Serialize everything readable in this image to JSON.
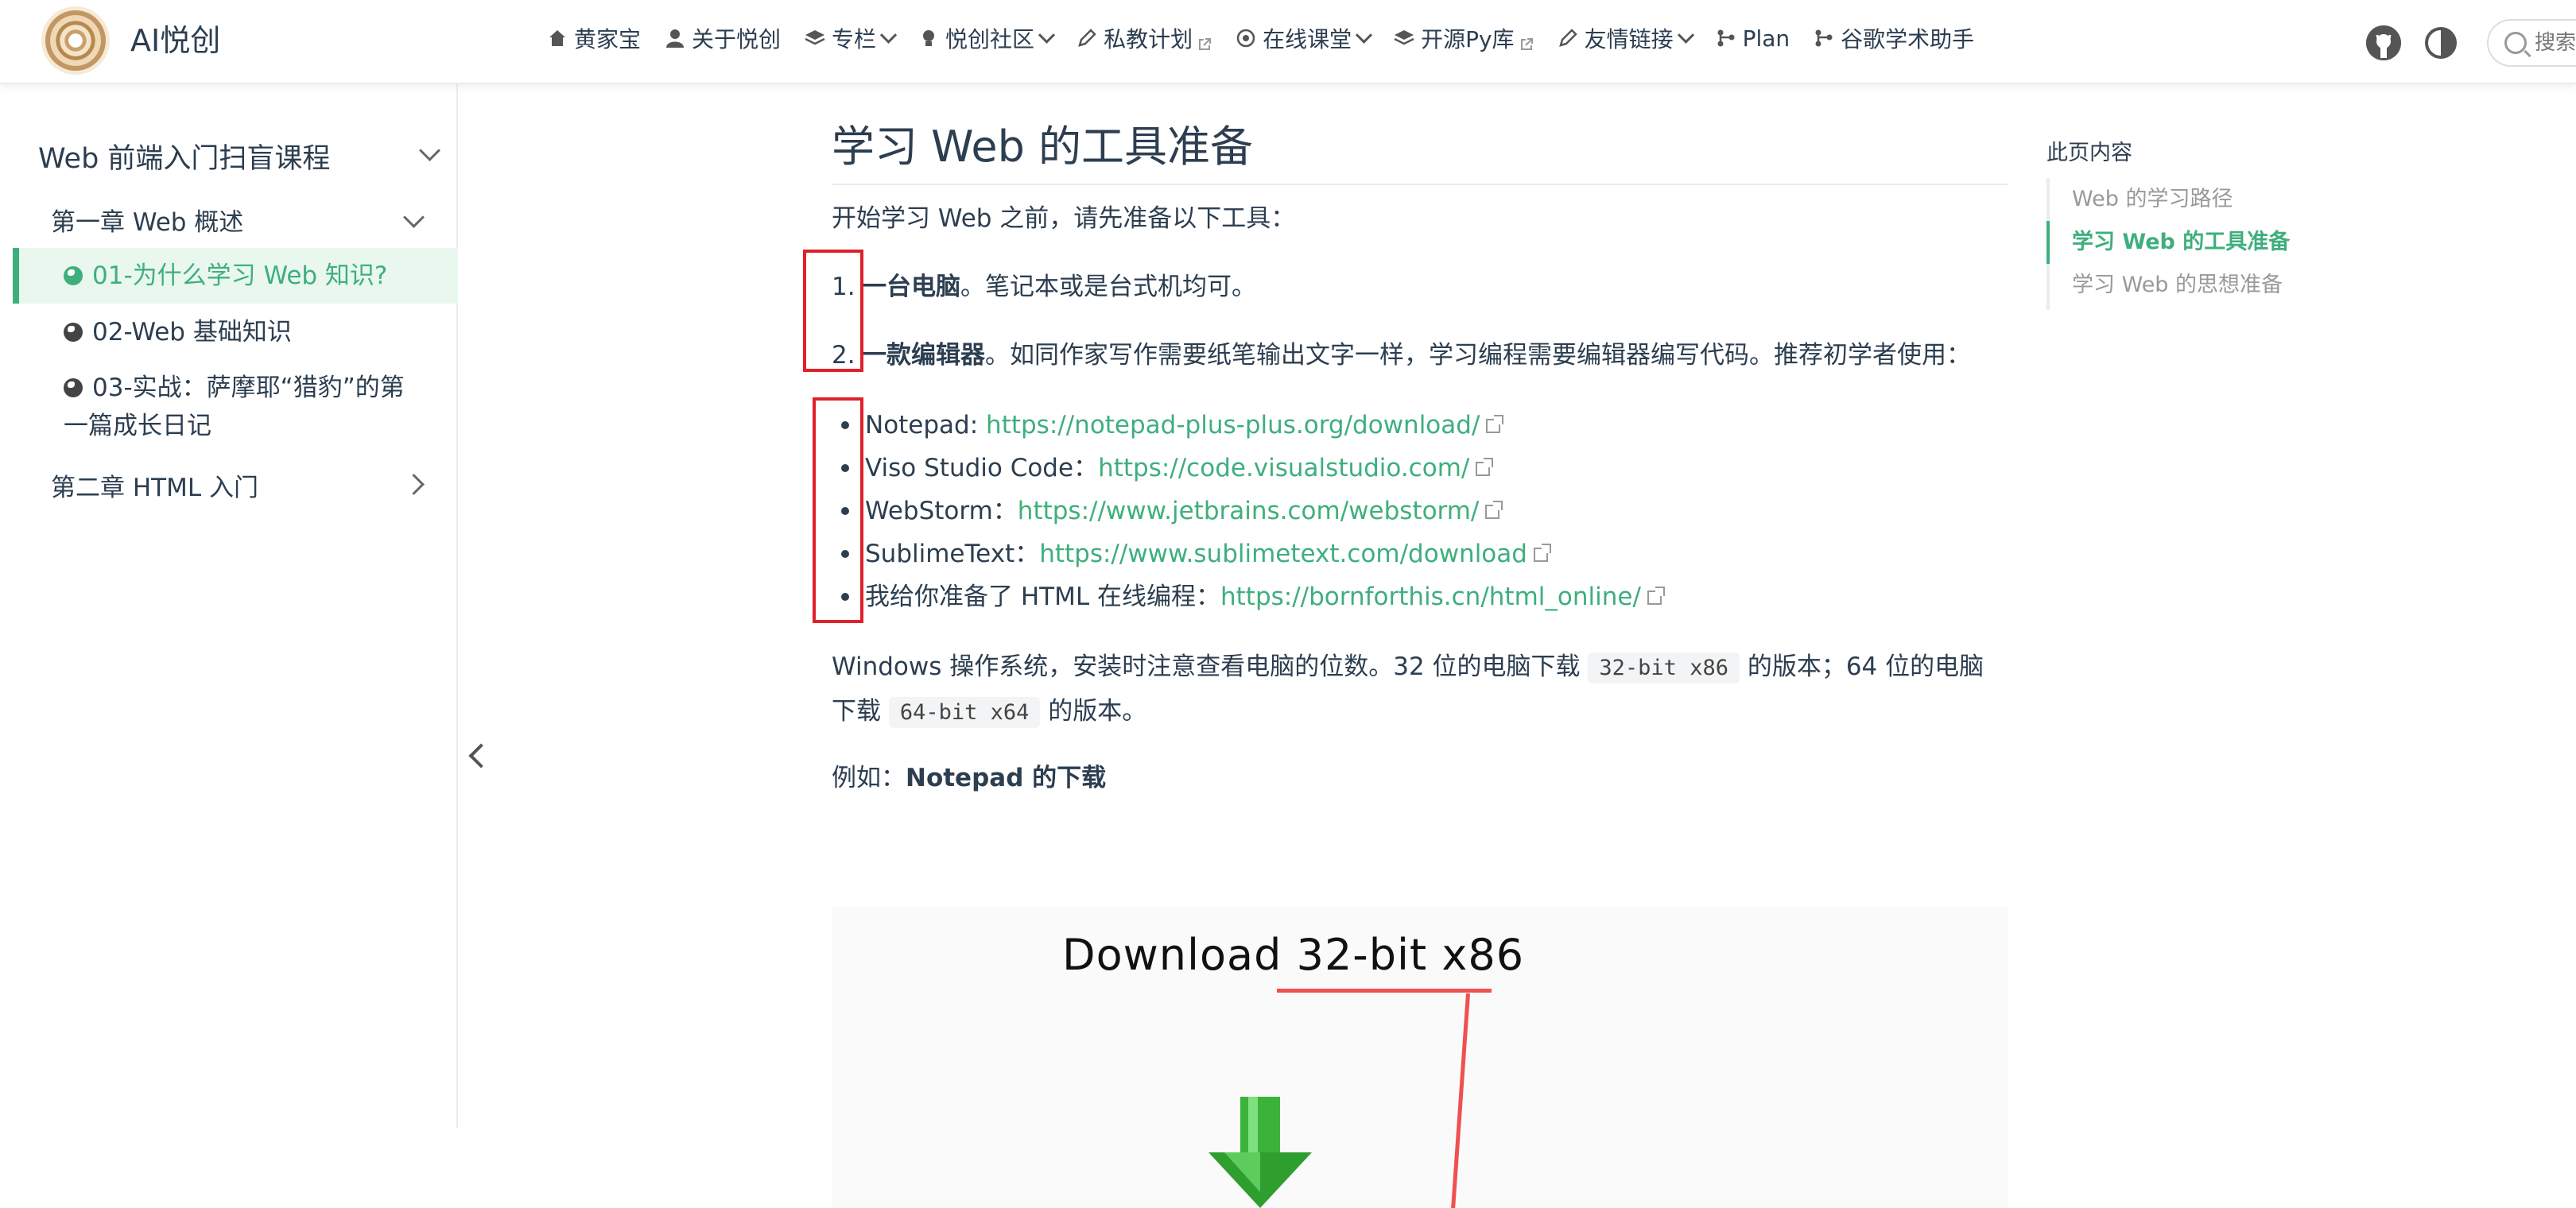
{
  "brand": {
    "name": "AI悦创"
  },
  "nav": {
    "items": [
      {
        "label": "黄家宝",
        "icon": "home-icon",
        "dropdown": false,
        "external": false
      },
      {
        "label": "关于悦创",
        "icon": "user-icon",
        "dropdown": false,
        "external": false
      },
      {
        "label": "专栏",
        "icon": "layers-icon",
        "dropdown": true,
        "external": false
      },
      {
        "label": "悦创社区",
        "icon": "bulb-icon",
        "dropdown": true,
        "external": false
      },
      {
        "label": "私教计划",
        "icon": "pen-icon",
        "dropdown": false,
        "external": true
      },
      {
        "label": "在线课堂",
        "icon": "target-icon",
        "dropdown": true,
        "external": false
      },
      {
        "label": "开源Py库",
        "icon": "layers-icon",
        "dropdown": false,
        "external": true
      },
      {
        "label": "友情链接",
        "icon": "pen-icon",
        "dropdown": true,
        "external": false
      },
      {
        "label": "Plan",
        "icon": "branch-icon",
        "dropdown": false,
        "external": false
      },
      {
        "label": "谷歌学术助手",
        "icon": "branch-icon",
        "dropdown": false,
        "external": false
      }
    ],
    "search_placeholder": "搜索"
  },
  "sidebar": {
    "group_title": "Web 前端入门扫盲课程",
    "chapters": [
      {
        "label": "第一章 Web 概述",
        "expanded": true
      },
      {
        "label": "第二章 HTML 入门",
        "expanded": false
      }
    ],
    "links": [
      {
        "label": "01-为什么学习 Web 知识?",
        "active": true
      },
      {
        "label": "02-Web 基础知识",
        "active": false
      },
      {
        "label": "03-实战：萨摩耶“猎豹”的第",
        "label2": "一篇成长日记",
        "active": false
      }
    ]
  },
  "content": {
    "title": "学习 Web 的工具准备",
    "intro": "开始学习 Web 之前，请先准备以下工具：",
    "ol": [
      {
        "num": "1.",
        "strong": "一台电脑",
        "rest": "。笔记本或是台式机均可。"
      },
      {
        "num": "2.",
        "strong": "一款编辑器",
        "rest": "。如同作家写作需要纸笔输出文字一样，学习编程需要编辑器编写代码。推荐初学者使用："
      }
    ],
    "ul": [
      {
        "text": "Notepad: ",
        "link": "https://notepad-plus-plus.org/download/"
      },
      {
        "text": "Viso Studio Code：",
        "link": "https://code.visualstudio.com/"
      },
      {
        "text": "WebStorm：",
        "link": "https://www.jetbrains.com/webstorm/"
      },
      {
        "text": "SublimeText：",
        "link": "https://www.sublimetext.com/download"
      },
      {
        "text": "我给你准备了 HTML 在线编程：",
        "link": "https://bornforthis.cn/html_online/"
      }
    ],
    "win_p1": "Windows 操作系统，安装时注意查看电脑的位数。32 位的电脑下载",
    "code1": "32-bit x86",
    "win_p2": "的版本；64 位的电脑",
    "win_p3": "下载",
    "code2": "64-bit x64",
    "win_p4": "的版本。",
    "example_label": "例如：",
    "example_strong": "Notepad 的下载",
    "figure_text": "Download 32-bit x86"
  },
  "toc": {
    "title": "此页内容",
    "items": [
      {
        "label": "Web 的学习路径",
        "active": false
      },
      {
        "label": "学习 Web 的工具准备",
        "active": true
      },
      {
        "label": "学习 Web 的思想准备",
        "active": false
      }
    ]
  },
  "colors": {
    "accent": "#3eaf7c",
    "annotation": "#e0202a",
    "text": "#2c3e50"
  }
}
